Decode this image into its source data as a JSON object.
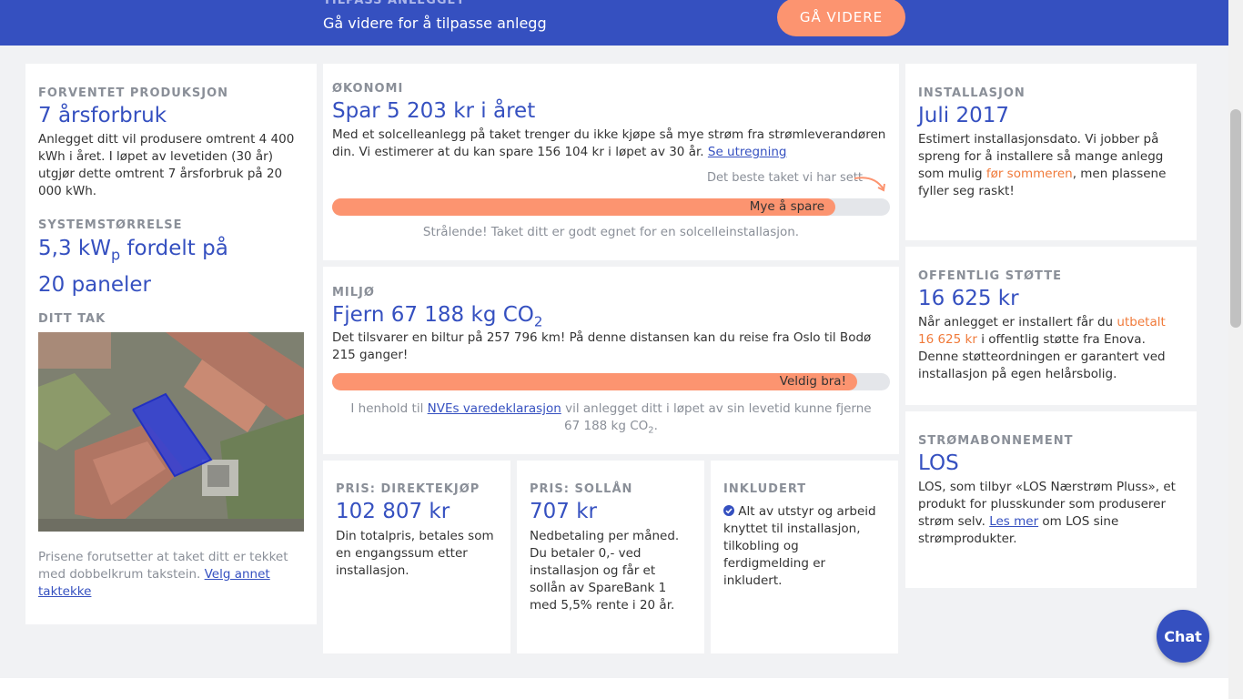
{
  "banner": {
    "kicker": "TILPASS ANLEGGET",
    "headline": "Gå videre for å tilpasse anlegg",
    "cta_label": "GÅ VIDERE"
  },
  "production": {
    "label": "FORVENTET PRODUKSJON",
    "value": "7 årsforbruk",
    "description": "Anlegget ditt vil produsere omtrent 4 400 kWh i året. I løpet av levetiden (30 år) utgjør dette omtrent 7 årsforbruk på 20 000 kWh."
  },
  "system": {
    "label": "SYSTEMSTØRRELSE",
    "value_main": "5,3 kW",
    "value_sub": "p",
    "value_rest": " fordelt på",
    "value_line2": "20 paneler"
  },
  "roof": {
    "label": "DITT TAK",
    "note": "Prisene forutsetter at taket ditt er tekket med dobbelkrum takstein.",
    "link": "Velg annet taktekke"
  },
  "economy": {
    "label": "ØKONOMI",
    "value": "Spar 5 203 kr i året",
    "description": "Med et solcelleanlegg på taket trenger du ikke kjøpe så mye strøm fra strømleverandøren din. Vi estimerer at du kan spare 156 104 kr i løpet av 30 år.",
    "link": "Se utregning",
    "best_roof_note": "Det beste taket vi har sett",
    "bar_label": "Mye å spare",
    "bar_fraction": 0.902,
    "footer": "Strålende! Taket ditt er godt egnet for en solcelleinstallasjon."
  },
  "environment": {
    "label": "MILJØ",
    "value_main": "Fjern 67 188 kg CO",
    "value_sub": "2",
    "description": "Det tilsvarer en biltur på 257 796 km! På denne distansen kan du reise fra Oslo til Bodø 215 ganger!",
    "bar_label": "Veldig bra!",
    "bar_fraction": 0.941,
    "footer_pre": "I henhold til",
    "footer_link": "NVEs varedeklarasjon",
    "footer_post": "vil anlegget ditt i løpet av sin levetid kunne fjerne",
    "footer_line2": "67 188 kg CO",
    "footer_sub": "2",
    "footer_end": "."
  },
  "price_direct": {
    "label": "PRIS: DIREKTEKJØP",
    "value": "102 807 kr",
    "description": "Din totalpris, betales som en engangssum etter installasjon."
  },
  "price_loan": {
    "label": "PRIS: SOLLÅN",
    "value": "707 kr",
    "description": "Nedbetaling per måned. Du betaler 0,- ved installasjon og får et sollån av SpareBank 1 med 5,5% rente i 20 år."
  },
  "included": {
    "label": "INKLUDERT",
    "description": "Alt av utstyr og arbeid knyttet til installasjon, tilkobling og ferdigmelding er inkludert."
  },
  "installation": {
    "label": "INSTALLASJON",
    "value": "Juli 2017",
    "text_pre": "Estimert installasjonsdato. Vi jobber på spreng for å installere så mange anlegg som mulig",
    "text_highlight": "før sommeren",
    "text_post": ", men plassene fyller seg raskt!"
  },
  "support": {
    "label": "OFFENTLIG STØTTE",
    "value": "16 625 kr",
    "text_pre": "Når anlegget er installert får du",
    "text_highlight": "utbetalt 16 625 kr",
    "text_post": "i offentlig støtte fra Enova. Denne støtteordningen er garantert ved installasjon på egen helårsbolig."
  },
  "subscription": {
    "label": "STRØMABONNEMENT",
    "value": "LOS",
    "text_pre": "LOS, som tilbyr «LOS Nærstrøm Pluss», et produkt for plusskunder som produserer strøm selv.",
    "link": "Les mer",
    "text_post": "om LOS sine strømprodukter."
  },
  "chat": {
    "label": "Chat"
  },
  "colors": {
    "brand": "#3550c0",
    "accent": "#fc9470",
    "highlight": "#f07a3a"
  }
}
